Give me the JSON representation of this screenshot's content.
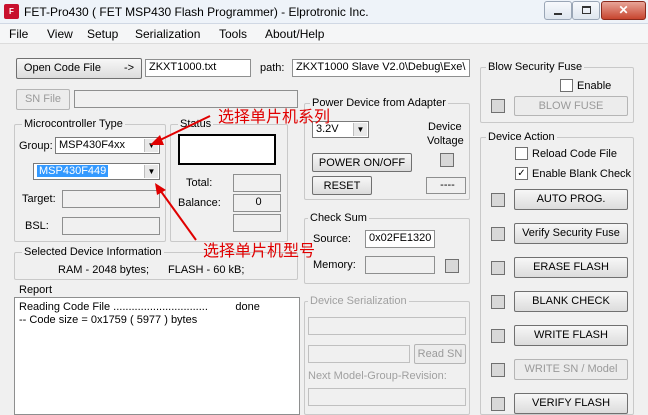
{
  "window": {
    "title": "FET-Pro430  ( FET MSP430 Flash Programmer)  -  Elprotronic Inc."
  },
  "menu": [
    "File",
    "View",
    "Setup",
    "Serialization",
    "Tools",
    "About/Help"
  ],
  "file": {
    "open_code_label": "Open Code File",
    "arrow_label": "->",
    "file_name": "ZKXT1000.txt",
    "path_label": "path:",
    "path_value": "ZKXT1000 Slave V2.0\\Debug\\Exe\\"
  },
  "sn_file": {
    "label": "SN File"
  },
  "microcontroller": {
    "legend": "Microcontroller Type",
    "group_label": "Group:",
    "group_value": "MSP430F4xx",
    "model_value": "MSP430F449",
    "target_label": "Target:",
    "bsl_label": "BSL:"
  },
  "status": {
    "legend": "Status",
    "total_label": "Total:",
    "balance_label": "Balance:",
    "balance_value": "0"
  },
  "power": {
    "legend": "Power Device from Adapter",
    "voltage": "3.2V",
    "device_voltage_label_1": "Device",
    "device_voltage_label_2": "Voltage",
    "power_button": "POWER ON/OFF",
    "reset_button": "RESET",
    "voltage_display": "----"
  },
  "checksum": {
    "legend": "Check Sum",
    "source_label": "Source:",
    "source_value": "0x02FE1320",
    "memory_label": "Memory:"
  },
  "selected_device": {
    "legend": "Selected Device Information",
    "ram": "RAM  -  2048 bytes;",
    "flash": "FLASH - 60 kB;"
  },
  "report": {
    "legend": "Report",
    "lines": [
      "Reading Code File ...............................         done",
      "-- Code size = 0x1759 ( 5977 ) bytes"
    ]
  },
  "serialization": {
    "legend": "Device Serialization",
    "read_sn": "Read SN",
    "next_model_label": "Next Model-Group-Revision:"
  },
  "blow_fuse": {
    "legend": "Blow Security Fuse",
    "enable_label": "Enable",
    "button": "BLOW FUSE"
  },
  "device_action": {
    "legend": "Device Action",
    "reload_label": "Reload Code File",
    "enable_blank_label": "Enable Blank Check",
    "enable_blank_mark": "✓",
    "buttons": [
      "AUTO PROG.",
      "Verify Security Fuse",
      "ERASE FLASH",
      "BLANK CHECK",
      "WRITE FLASH",
      "WRITE SN / Model",
      "VERIFY FLASH"
    ]
  },
  "annotations": {
    "series": "选择单片机系列",
    "model": "选择单片机型号"
  },
  "colors": {
    "annotation": "#e00000",
    "selection": "#3399ff"
  }
}
